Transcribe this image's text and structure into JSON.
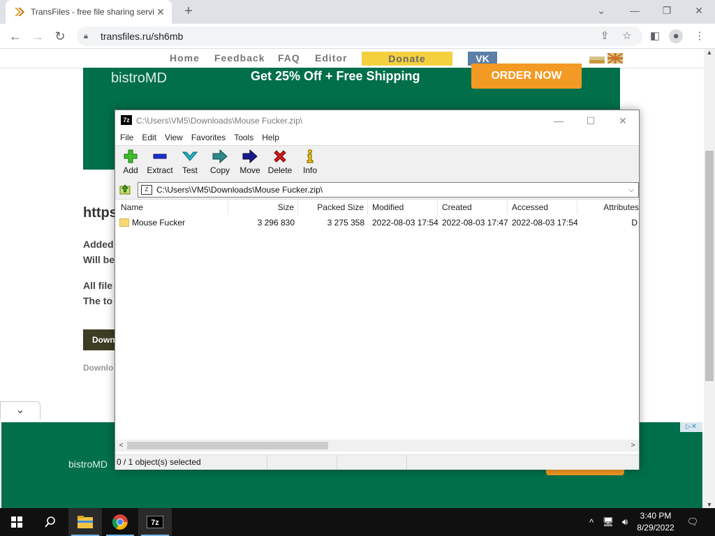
{
  "browser": {
    "tab_title": "TransFiles - free file sharing servi",
    "tab_close": "✕",
    "new_tab": "+",
    "url": "transfiles.ru/sh6mb",
    "window_buttons": {
      "minimize": "—",
      "maximize": "❐",
      "close": "✕"
    }
  },
  "site": {
    "nav": [
      "Home",
      "Feedback",
      "FAQ",
      "Editor"
    ],
    "donate": "Donate",
    "vk": "VK",
    "ad_top": {
      "brand": "bistroMD",
      "offer": "Get 25% Off + Free Shipping",
      "cta": "ORDER NOW"
    },
    "heading_fragment": "https",
    "para1_line1": "Added",
    "para1_line2": "Will be",
    "para2_line1": "All file",
    "para2_line2": "The to",
    "download_button": "Down",
    "download_link": "Downlo",
    "ad_bottom": {
      "brand": "bistroMD",
      "adchoice": "▷✕"
    }
  },
  "sevenzip": {
    "title": "C:\\Users\\VM5\\Downloads\\Mouse Fucker.zip\\",
    "app_icon": "7z",
    "menu": [
      "File",
      "Edit",
      "View",
      "Favorites",
      "Tools",
      "Help"
    ],
    "toolbar": [
      {
        "label": "Add",
        "icon": "plus-icon",
        "color": "#3cbf2a"
      },
      {
        "label": "Extract",
        "icon": "minus-icon",
        "color": "#1b2fd0"
      },
      {
        "label": "Test",
        "icon": "check-icon",
        "color": "#19b6c9"
      },
      {
        "label": "Copy",
        "icon": "copy-arrow-icon",
        "color": "#2e8b8b"
      },
      {
        "label": "Move",
        "icon": "move-arrow-icon",
        "color": "#1a1a8c"
      },
      {
        "label": "Delete",
        "icon": "delete-icon",
        "color": "#d11a1a"
      },
      {
        "label": "Info",
        "icon": "info-icon",
        "color": "#d4a000"
      }
    ],
    "address": "C:\\Users\\VM5\\Downloads\\Mouse Fucker.zip\\",
    "columns": [
      "Name",
      "Size",
      "Packed Size",
      "Modified",
      "Created",
      "Accessed",
      "Attributes"
    ],
    "rows": [
      {
        "name": "Mouse Fucker",
        "size": "3 296 830",
        "packed": "3 275 358",
        "modified": "2022-08-03 17:54",
        "created": "2022-08-03 17:47",
        "accessed": "2022-08-03 17:54",
        "attr": "D"
      }
    ],
    "status": "0 / 1 object(s) selected"
  },
  "taskbar": {
    "time": "3:40 PM",
    "date": "8/29/2022",
    "apps": [
      "file-explorer",
      "chrome",
      "7-zip"
    ]
  }
}
